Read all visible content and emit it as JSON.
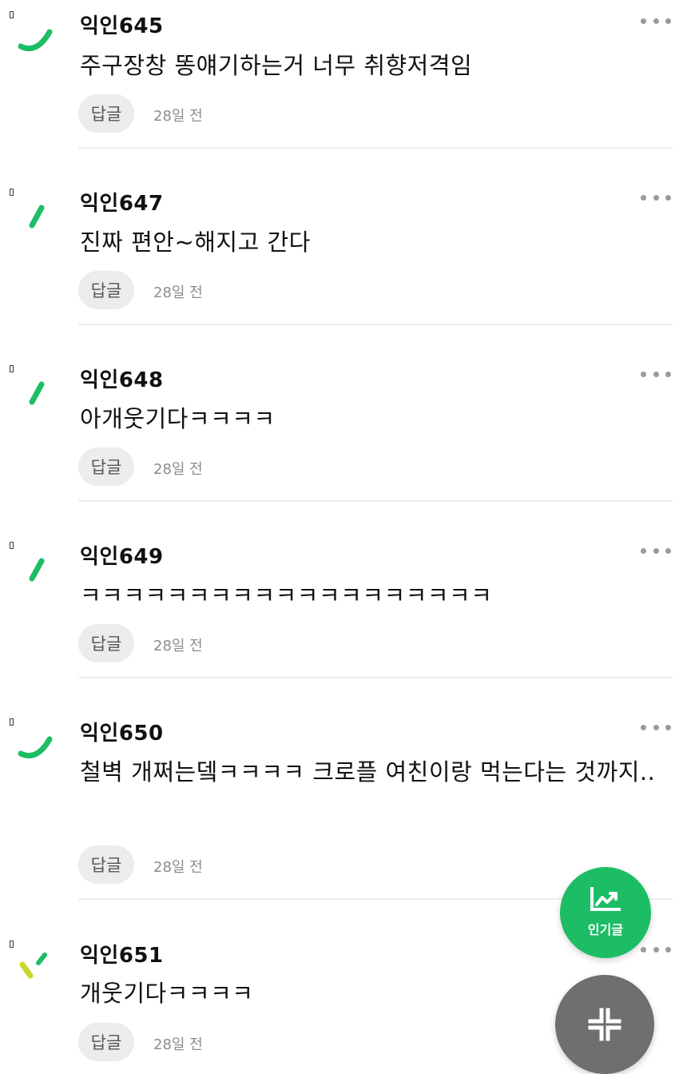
{
  "comments": [
    {
      "author": "익인645",
      "body": "주구장창 똥얘기하는거 너무 취향저격임",
      "reply_label": "답글",
      "time": "28일 전",
      "avatar_icon": "green-arc-icon",
      "avatar_color": "#1dbd66"
    },
    {
      "author": "익인647",
      "body": "진짜 편안~해지고 간다",
      "reply_label": "답글",
      "time": "28일 전",
      "avatar_icon": "green-slash-icon",
      "avatar_color": "#1dbd66"
    },
    {
      "author": "익인648",
      "body": "아개웃기다ㅋㅋㅋㅋ",
      "reply_label": "답글",
      "time": "28일 전",
      "avatar_icon": "green-slash-icon",
      "avatar_color": "#1dbd66"
    },
    {
      "author": "익인649",
      "body": "ㅋㅋㅋㅋㅋㅋㅋㅋㅋㅋㅋㅋㅋㅋㅋㅋㅋㅋㅋ",
      "reply_label": "답글",
      "time": "28일 전",
      "avatar_icon": "green-slash-icon",
      "avatar_color": "#1dbd66"
    },
    {
      "author": "익인650",
      "body": "철벽 개쩌는뎈ㅋㅋㅋㅋ 크로플 여친이랑 먹는다는 것까지..",
      "reply_label": "답글",
      "time": "28일 전",
      "avatar_icon": "green-arc-icon",
      "avatar_color": "#1dbd66"
    },
    {
      "author": "익인651",
      "body": "개웃기다ㅋㅋㅋㅋ",
      "reply_label": "답글",
      "time": "28일 전",
      "avatar_icon": "yellow-green-check-icon",
      "avatar_color": "#c9d62a"
    }
  ],
  "fab": {
    "popular_label": "인기글",
    "popular_icon": "trending-chart-icon",
    "popular_color": "#1dbd66",
    "collapse_icon": "collapse-arrows-icon",
    "collapse_color": "#6f6f6f"
  }
}
